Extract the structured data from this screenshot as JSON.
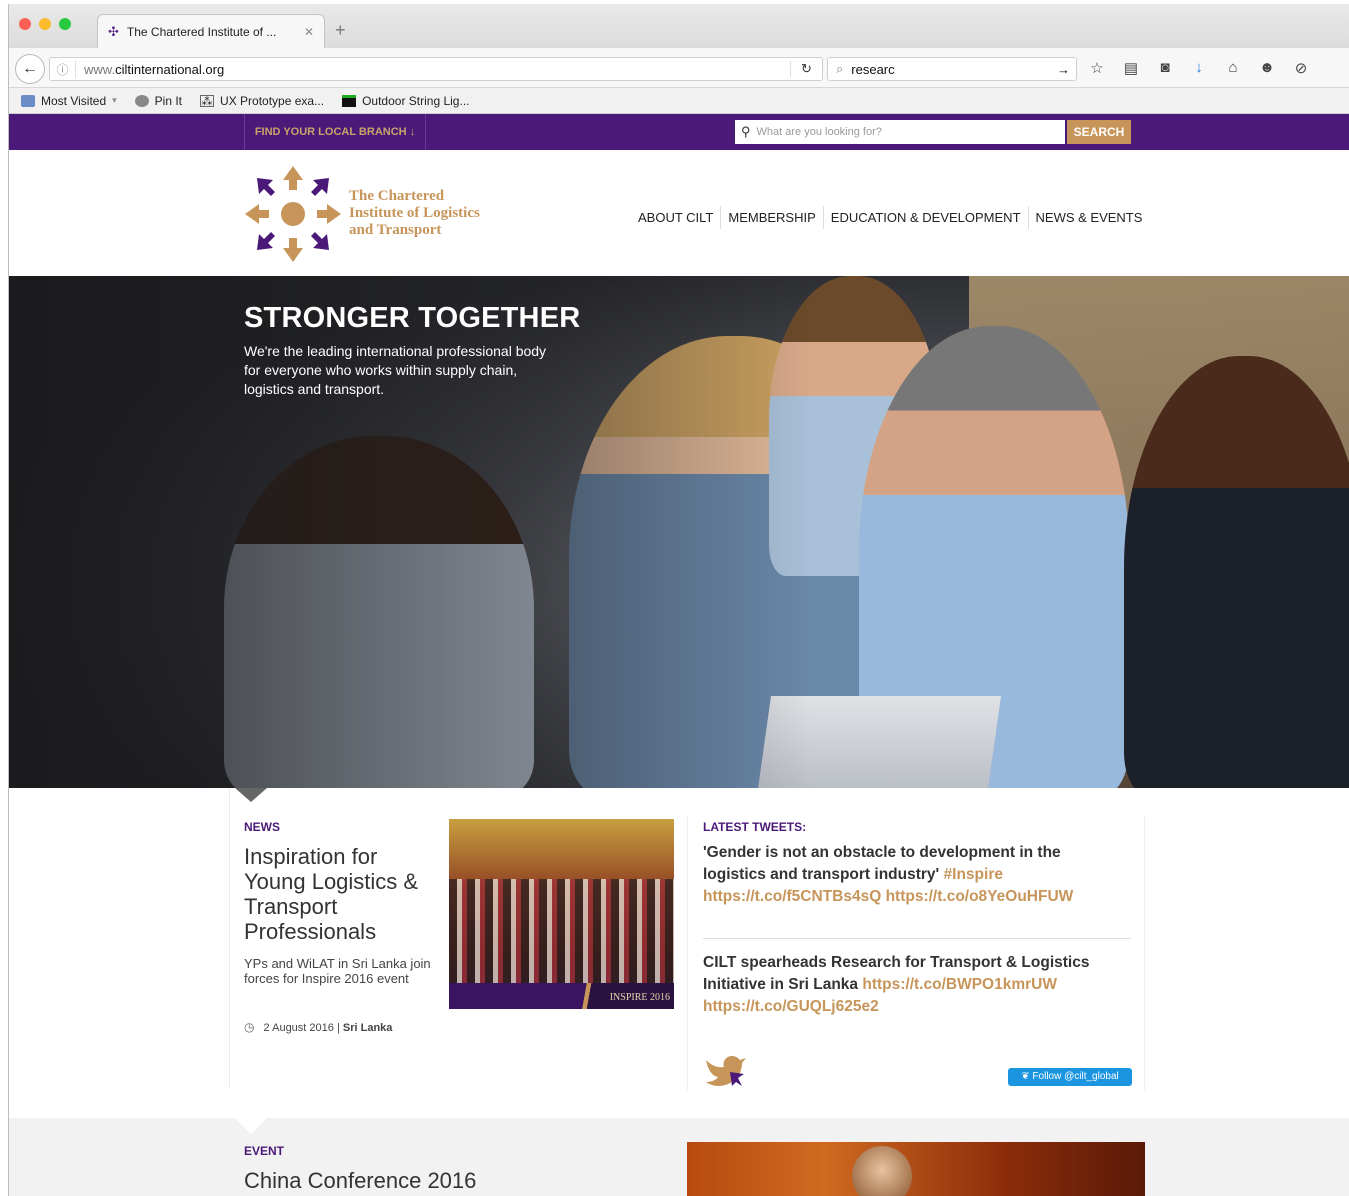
{
  "browser": {
    "tab_title": "The Chartered Institute of ...",
    "url_prefix": "www.",
    "url_domain": "ciltinternational.org",
    "search_text": "researc",
    "bookmarks": [
      {
        "label": "Most Visited",
        "icon": "most-visited-icon"
      },
      {
        "label": "Pin It",
        "icon": "pinterest-icon"
      },
      {
        "label": "UX Prototype exa...",
        "icon": "ux-prototype-icon"
      },
      {
        "label": "Outdoor String Lig...",
        "icon": "outdoor-lights-icon"
      }
    ]
  },
  "site": {
    "find_branch": "FIND YOUR LOCAL BRANCH ↓",
    "search_placeholder": "What are you looking for?",
    "search_button": "SEARCH",
    "logo_line1": "The Chartered",
    "logo_line2": "Institute of Logistics",
    "logo_line3": "and Transport",
    "nav": [
      "ABOUT CILT",
      "MEMBERSHIP",
      "EDUCATION & DEVELOPMENT",
      "NEWS & EVENTS"
    ],
    "colors": {
      "brand_purple": "#4b1a78",
      "brand_gold": "#c7955a",
      "twitter_blue": "#1b95e0"
    }
  },
  "hero": {
    "title": "STRONGER TOGETHER",
    "text": "We're the leading international professional body for everyone who works within supply chain, logistics and transport."
  },
  "news": {
    "label": "NEWS",
    "title": "Inspiration for Young Logistics & Transport Professionals",
    "description": "YPs and WiLAT in Sri Lanka join forces for Inspire 2016 event",
    "date": "2 August 2016 |",
    "location": "Sri Lanka",
    "image_text": "INSPIRE 2016"
  },
  "tweets": {
    "label": "LATEST TWEETS:",
    "tweet1_text": "'Gender is not an obstacle to development in the logistics and transport industry'",
    "tweet1_links": "#Inspire https://t.co/f5CNTBs4sQ https://t.co/o8YeOuHFUW",
    "tweet2_text": "CILT spearheads Research for Transport & Logistics Initiative in Sri Lanka",
    "tweet2_links": "https://t.co/BWPO1kmrUW https://t.co/GUQLj625e2",
    "follow_button": "Follow @cilt_global"
  },
  "event": {
    "label": "EVENT",
    "title": "China Conference 2016"
  }
}
